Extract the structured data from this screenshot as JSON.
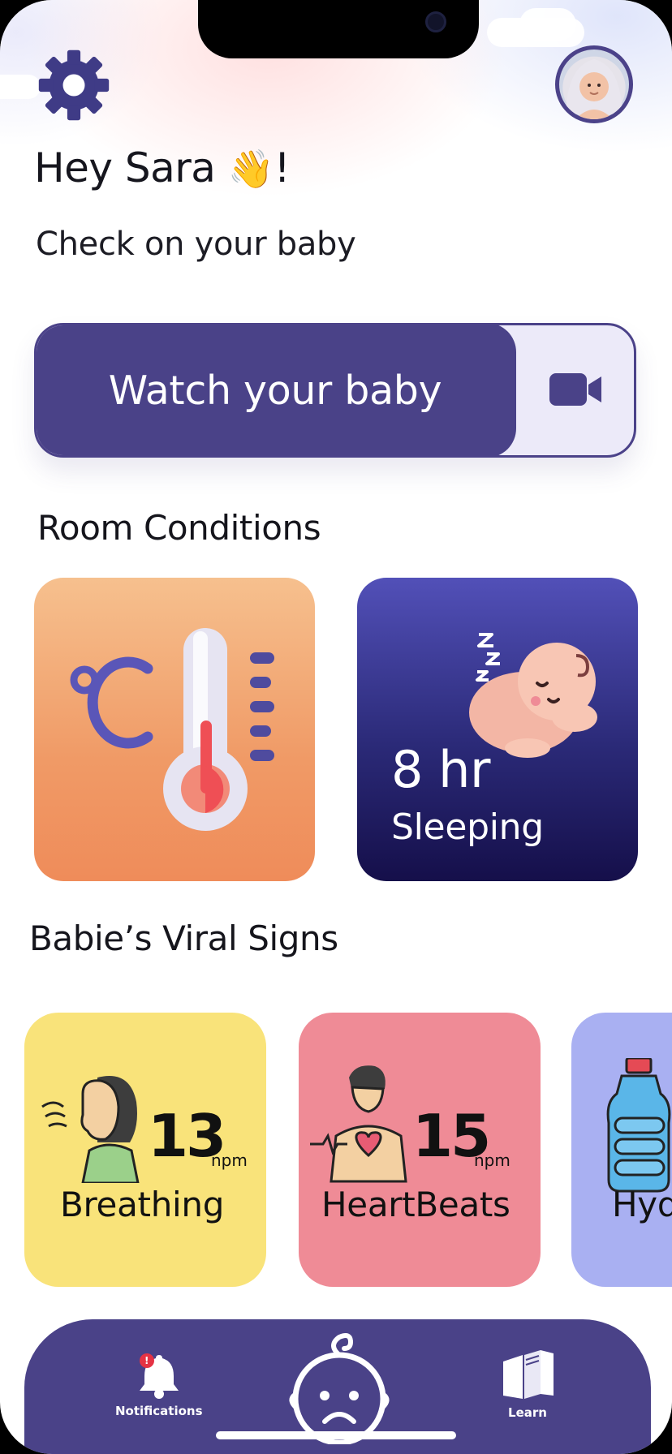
{
  "header": {
    "greeting_prefix": "Hey Sara ",
    "greeting_emoji": "👋",
    "greeting_suffix": "!",
    "subtitle": "Check on your baby",
    "settings_icon": "gear-icon",
    "avatar_icon": "baby-avatar"
  },
  "watch": {
    "label": "Watch your baby",
    "icon": "video-camera-icon"
  },
  "room_conditions": {
    "title": "Room Conditions",
    "temperature": {
      "icon": "thermometer-icon",
      "unit_symbol": "°C"
    },
    "sleep": {
      "value": "8 hr",
      "label": "Sleeping",
      "icon": "sleeping-baby-icon"
    }
  },
  "vital_signs": {
    "title": "Babie’s Viral Signs",
    "items": [
      {
        "label": "Breathing",
        "value": "13",
        "unit": "npm",
        "icon": "breathing-person-icon",
        "color": "#f9e37a"
      },
      {
        "label": "HeartBeats",
        "value": "15",
        "unit": "npm",
        "icon": "heartbeat-person-icon",
        "color": "#ef8b96"
      },
      {
        "label": "Hyd",
        "value": "",
        "unit": "",
        "icon": "water-bottle-icon",
        "color": "#a9b0f2"
      }
    ]
  },
  "nav": {
    "notifications_label": "Notifications",
    "notifications_badge": "!",
    "learn_label": "Learn",
    "center_icon": "baby-face-icon"
  },
  "colors": {
    "primary": "#4a4288",
    "temp_card": "#f09a66",
    "sleep_card": "#2b2a78"
  }
}
